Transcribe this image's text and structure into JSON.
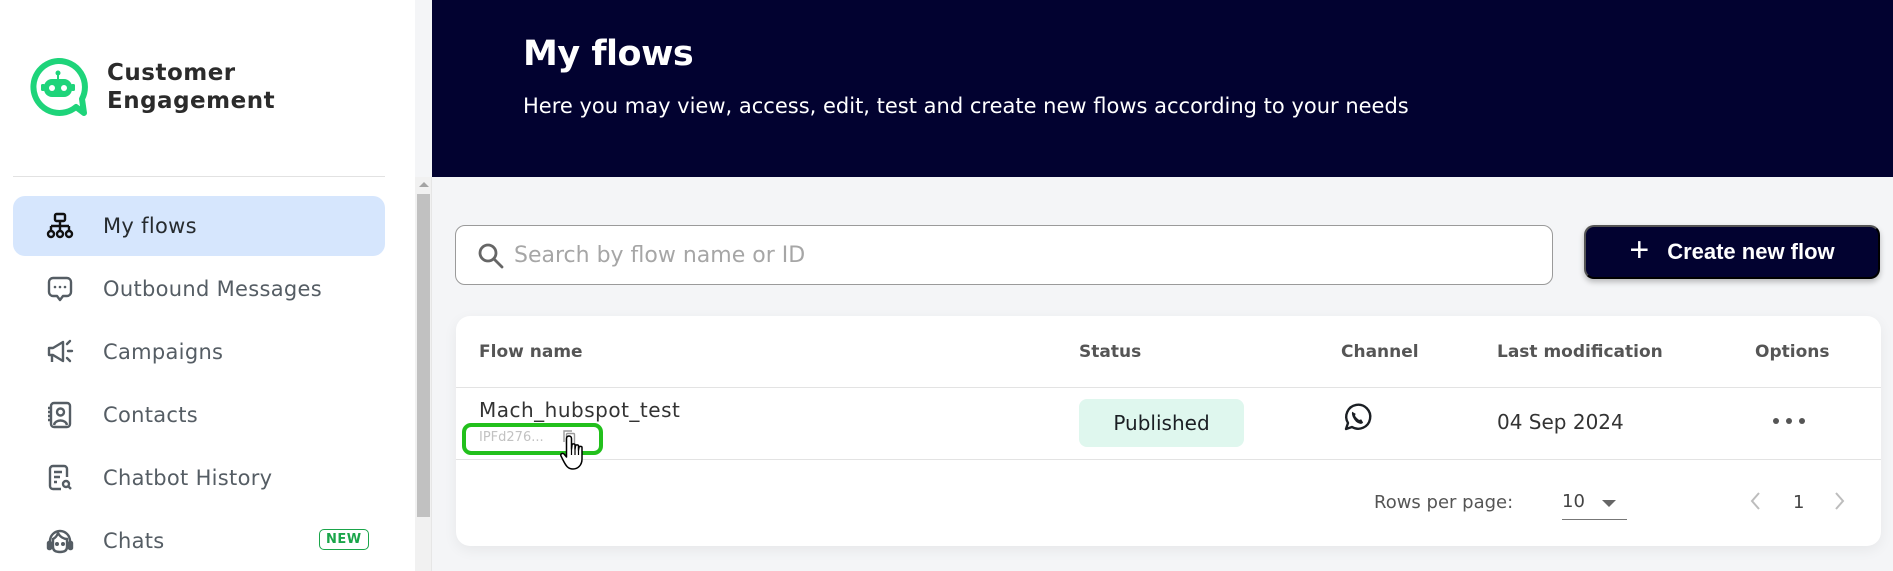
{
  "brand": {
    "name_line1": "Customer",
    "name_line2": "Engagement",
    "logo_icon": "robot-chat-bubble-icon",
    "accent": "#1ed47a"
  },
  "sidebar": {
    "items": [
      {
        "label": "My flows",
        "icon": "sitemap-icon",
        "active": true
      },
      {
        "label": "Outbound Messages",
        "icon": "chat-dots-icon",
        "active": false
      },
      {
        "label": "Campaigns",
        "icon": "megaphone-icon",
        "active": false
      },
      {
        "label": "Contacts",
        "icon": "contact-book-icon",
        "active": false
      },
      {
        "label": "Chatbot History",
        "icon": "document-search-icon",
        "active": false
      },
      {
        "label": "Chats",
        "icon": "headset-agent-icon",
        "active": false,
        "badge": "NEW"
      }
    ]
  },
  "header": {
    "title": "My flows",
    "subtitle": "Here you may view, access, edit, test and create new flows according to your needs",
    "background": "#020230"
  },
  "search": {
    "placeholder": "Search by flow name or ID",
    "value": ""
  },
  "actions": {
    "create_label": "Create new flow",
    "create_icon": "plus-icon"
  },
  "table": {
    "columns": [
      "Flow name",
      "Status",
      "Channel",
      "Last modification",
      "Options"
    ],
    "rows": [
      {
        "name": "Mach_hubspot_test",
        "id": "IPFd276...",
        "status": "Published",
        "channel": "whatsapp-icon",
        "last_modification": "04 Sep 2024",
        "options": "more-horizontal-icon"
      }
    ],
    "status_colors": {
      "Published": "#dff7ee"
    }
  },
  "pagination": {
    "rows_per_page_label": "Rows per page:",
    "rows_per_page": "10",
    "current_page": "1"
  },
  "highlight": {
    "color": "#22c01c",
    "target": "flow-id-copy"
  }
}
